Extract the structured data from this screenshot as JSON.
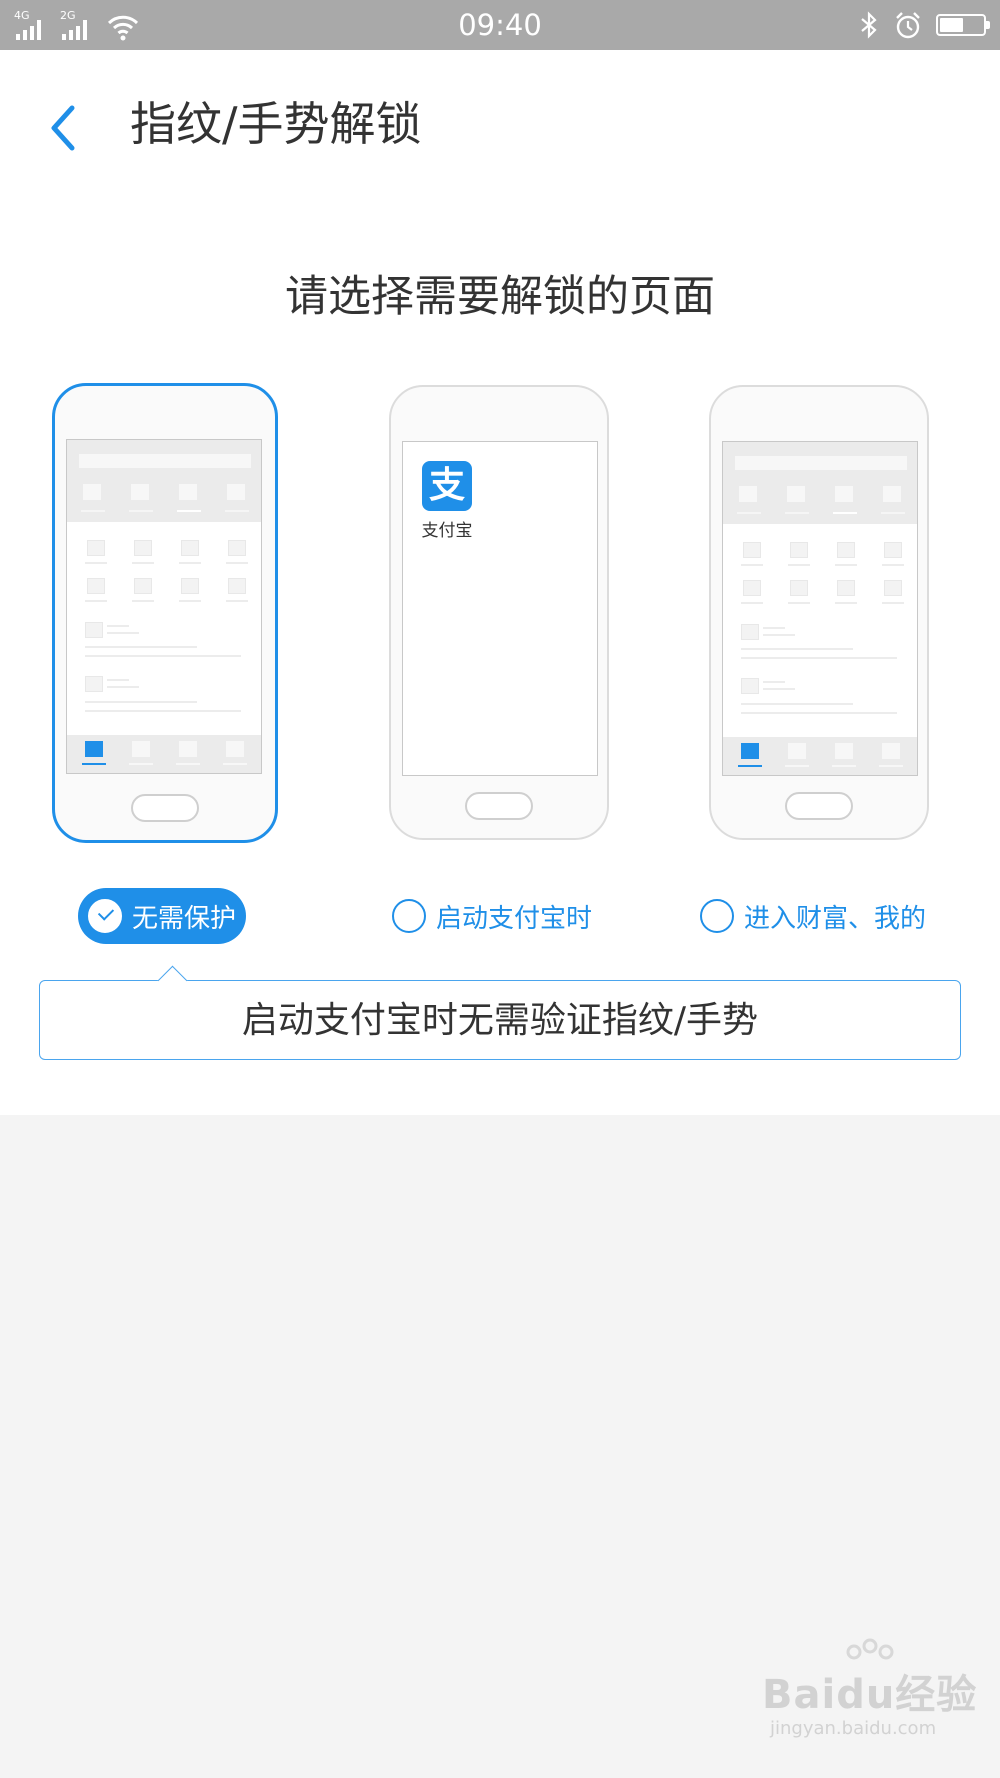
{
  "status_bar": {
    "network_1": "4G",
    "network_2": "2G",
    "time": "09:40",
    "icons": [
      "signal-icon",
      "signal-icon",
      "wifi-icon",
      "bluetooth-icon",
      "alarm-icon",
      "battery-icon"
    ],
    "battery_level": 0.55
  },
  "header": {
    "back_icon": "chevron-left-icon",
    "title": "指纹/手势解锁"
  },
  "prompt": "请选择需要解锁的页面",
  "phones": {
    "alipay_app_name": "支付宝",
    "alipay_logo_char": "支"
  },
  "options": [
    {
      "label": "无需保护",
      "selected": true
    },
    {
      "label": "启动支付宝时",
      "selected": false
    },
    {
      "label": "进入财富、我的",
      "selected": false
    }
  ],
  "description": "启动支付宝时无需验证指纹/手势",
  "watermark": {
    "brand": "Baidu经验",
    "url": "jingyan.baidu.com"
  },
  "colors": {
    "accent": "#1f8fe8",
    "status_bar": "#a9a9a9",
    "page_background": "#f4f4f4"
  }
}
